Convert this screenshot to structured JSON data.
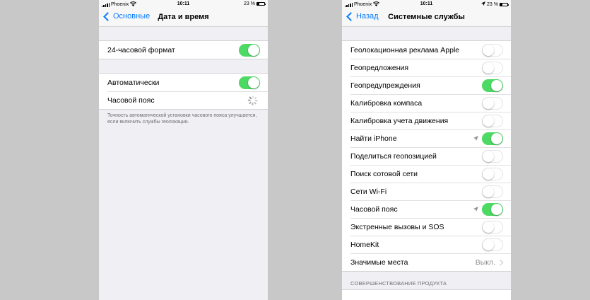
{
  "left": {
    "status": {
      "carrier": "Phoenix",
      "time": "10:11",
      "battery": "23 %"
    },
    "nav": {
      "back": "Основные",
      "title": "Дата и время"
    },
    "group1": [
      {
        "label": "24-часовой формат",
        "toggle": "on"
      }
    ],
    "group2": [
      {
        "label": "Автоматически",
        "toggle": "on"
      },
      {
        "label": "Часовой пояс"
      }
    ],
    "footnote": "Точность автоматической установки часового пояса улучшается, если включить службы геолокации."
  },
  "right": {
    "status": {
      "carrier": "Phoenix",
      "time": "10:11",
      "battery": "23 %"
    },
    "nav": {
      "back": "Назад",
      "title": "Системные службы"
    },
    "rows": [
      {
        "label": "Геолокационная реклама Apple",
        "toggle": "off"
      },
      {
        "label": "Геопредложения",
        "toggle": "off"
      },
      {
        "label": "Геопредупреждения",
        "toggle": "on"
      },
      {
        "label": "Калибровка компаса",
        "toggle": "off"
      },
      {
        "label": "Калибровка учета движения",
        "toggle": "off"
      },
      {
        "label": "Найти iPhone",
        "toggle": "on",
        "location": true
      },
      {
        "label": "Поделиться геопозицией",
        "toggle": "off"
      },
      {
        "label": "Поиск сотовой сети",
        "toggle": "off"
      },
      {
        "label": "Сети Wi-Fi",
        "toggle": "off"
      },
      {
        "label": "Часовой пояс",
        "toggle": "on",
        "location": true
      },
      {
        "label": "Экстренные вызовы и SOS",
        "toggle": "off"
      },
      {
        "label": "HomeKit",
        "toggle": "off"
      },
      {
        "label": "Значимые места",
        "detail": "Выкл."
      }
    ],
    "section_header": "СОВЕРШЕНСТВОВАНИЕ ПРОДУКТА"
  },
  "colors": {
    "accent": "#0a7aff",
    "toggle_on": "#4cd964",
    "background": "#efeff4"
  },
  "icons": [
    "signal-bars-icon",
    "wifi-icon",
    "battery-icon",
    "location-arrow-icon",
    "chevron-left-icon",
    "chevron-right-icon",
    "spinner-icon"
  ]
}
